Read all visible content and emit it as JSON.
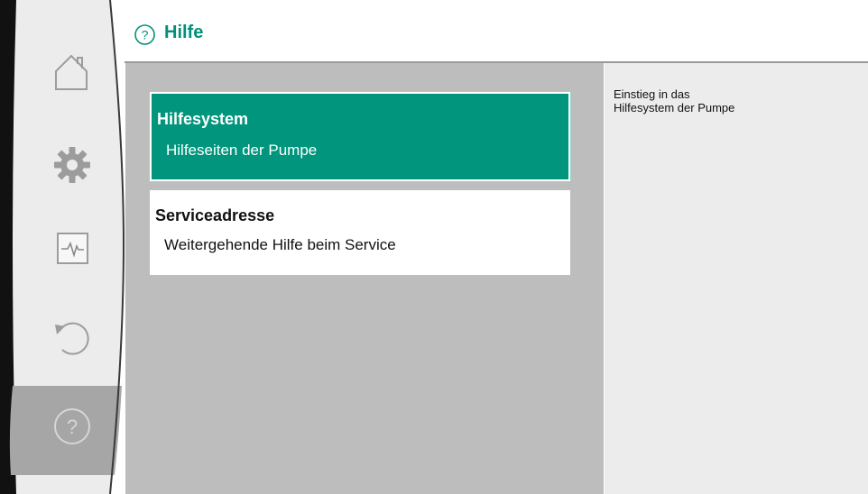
{
  "header": {
    "title": "Hilfe",
    "icon": "help-circle-icon",
    "title_color": "#00917a"
  },
  "sidebar": {
    "items": [
      {
        "name": "home",
        "icon": "home-icon",
        "active": false
      },
      {
        "name": "settings",
        "icon": "gear-icon",
        "active": false
      },
      {
        "name": "diagnostics",
        "icon": "pulse-monitor-icon",
        "active": false
      },
      {
        "name": "restore",
        "icon": "undo-arrow-icon",
        "active": false
      },
      {
        "name": "help",
        "icon": "help-circle-icon",
        "active": true
      }
    ]
  },
  "menu": {
    "items": [
      {
        "title": "Hilfesystem",
        "subtitle": "Hilfeseiten der Pumpe",
        "selected": true
      },
      {
        "title": "Serviceadresse",
        "subtitle": "Weitergehende Hilfe beim Service",
        "selected": false
      }
    ]
  },
  "info": {
    "line1": "Einstieg in das",
    "line2": "Hilfesystem der Pumpe"
  },
  "colors": {
    "accent": "#00957c",
    "menu_background": "#bdbdbd",
    "info_background": "#ececec",
    "sidebar_background": "#ececec",
    "sidebar_active": "#a6a6a6"
  }
}
